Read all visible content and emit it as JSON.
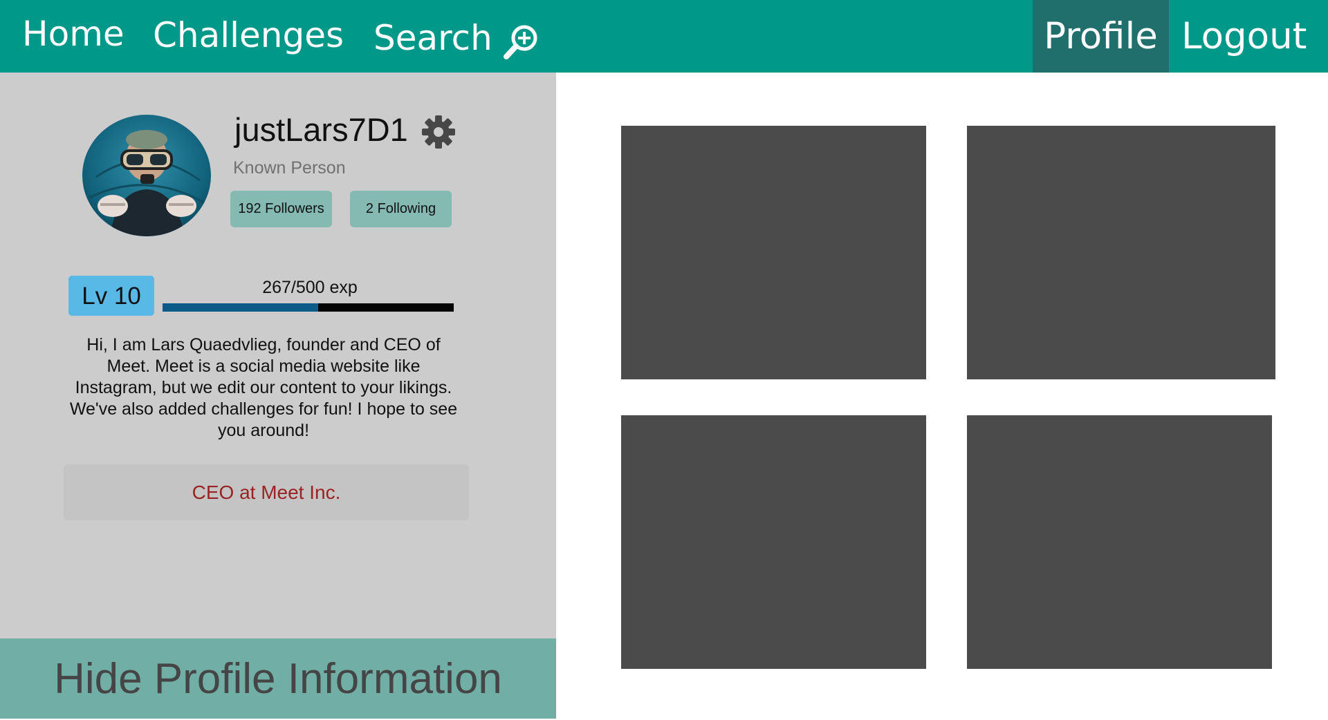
{
  "nav": {
    "home": "Home",
    "challenges": "Challenges",
    "search": "Search",
    "search_icon": "search-plus-icon",
    "profile": "Profile",
    "logout": "Logout",
    "colors": {
      "bar": "#009888",
      "active": "#216f6d",
      "text": "#ffffff"
    }
  },
  "profile": {
    "username": "justLars7D1",
    "settings_icon": "gear-icon",
    "subtitle": "Known Person",
    "followers": "192 Followers",
    "following": "2 Following",
    "level": "Lv 10",
    "exp_text": "267/500 exp",
    "exp_current": 267,
    "exp_max": 500,
    "bio": "Hi, I am Lars Quaedvlieg, founder and CEO of Meet. Meet is a social media website like Instagram, but we edit our content to your likings. We've also added challenges for fun! I hope to see you around!",
    "job": "CEO at Meet Inc.",
    "hide_button": "Hide Profile Information",
    "colors": {
      "job_text": "#9b2222",
      "level_badge": "#59b9e6",
      "exp_fill": "#0b5a87"
    }
  },
  "posts": [
    {
      "label": ""
    },
    {
      "label": ""
    },
    {
      "label": ""
    },
    {
      "label": ""
    }
  ]
}
